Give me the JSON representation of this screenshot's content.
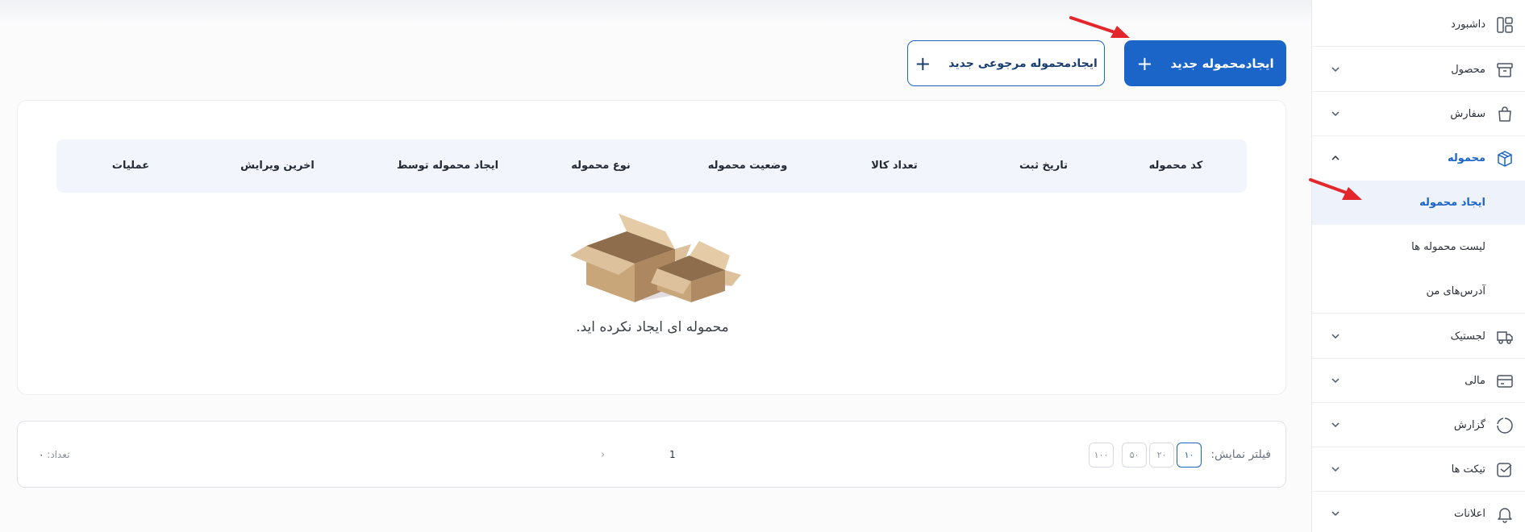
{
  "actions": {
    "create_shipment_label": "ایجادمحموله جدید",
    "create_return_shipment_label": "ایجادمحموله مرجوعی جدید",
    "plus_symbol": "+"
  },
  "table": {
    "columns": [
      "کد محموله",
      "تاریخ ثبت",
      "تعداد کالا",
      "وضعیت محموله",
      "نوع محموله",
      "ایجاد محموله توسط",
      "اخرین ویرایش",
      "عملیات"
    ],
    "empty_message": "محموله ای ایجاد نکرده اید."
  },
  "pagination": {
    "filter_label": "فیلتر نمایش:",
    "page_sizes": [
      "۱۰",
      "۲۰",
      "۵۰",
      "۱۰۰"
    ],
    "active_page_size": "۱۰",
    "current_page": "1",
    "next_symbol": "›",
    "count_label": "تعداد:",
    "count_value": "۰"
  },
  "sidebar": {
    "items": [
      {
        "label": "داشبورد",
        "icon": "dashboard-icon",
        "has_chevron": false
      },
      {
        "label": "محصول",
        "icon": "archive-box-icon",
        "has_chevron": true
      },
      {
        "label": "سفارش",
        "icon": "bag-icon",
        "has_chevron": true
      },
      {
        "label": "محموله",
        "icon": "package-icon",
        "has_chevron": true,
        "expanded": true
      },
      {
        "label": "لجستیک",
        "icon": "truck-icon",
        "has_chevron": true
      },
      {
        "label": "مالی",
        "icon": "card-icon",
        "has_chevron": true
      },
      {
        "label": "گزارش",
        "icon": "report-circle-icon",
        "has_chevron": true
      },
      {
        "label": "تیکت ها",
        "icon": "ticket-icon",
        "has_chevron": true
      },
      {
        "label": "اعلانات",
        "icon": "bell-icon",
        "has_chevron": true
      }
    ],
    "subitems": [
      {
        "label": "ایجاد محموله",
        "active": true
      },
      {
        "label": "لیست محموله ها",
        "active": false
      },
      {
        "label": "آدرس‌های من",
        "active": false
      }
    ]
  },
  "colors": {
    "primary": "#1b64c8",
    "active_bg": "#eef3fb",
    "table_header_bg": "#f2f6fc",
    "annotation_arrow": "#e3262b"
  }
}
